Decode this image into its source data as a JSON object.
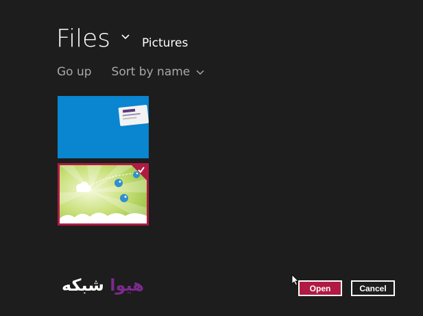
{
  "header": {
    "title": "Files",
    "location": "Pictures"
  },
  "toolbar": {
    "go_up_label": "Go up",
    "sort_label": "Sort by name"
  },
  "files": [
    {
      "kind": "image",
      "selected": false,
      "background": "#0a85d0"
    },
    {
      "kind": "image",
      "selected": true,
      "background": "#b9d96a"
    }
  ],
  "brand": {
    "word1": "هیوا",
    "word2": "شبکه"
  },
  "buttons": {
    "open_label": "Open",
    "cancel_label": "Cancel"
  },
  "colors": {
    "background": "#1d1d1d",
    "accent": "#b01a43",
    "secondary_text": "#a9a9a9"
  },
  "icons": {
    "title_dropdown": "chevron-down-icon",
    "sort_dropdown": "chevron-down-icon",
    "selected": "checkmark-icon",
    "pointer": "mouse-cursor-icon"
  }
}
